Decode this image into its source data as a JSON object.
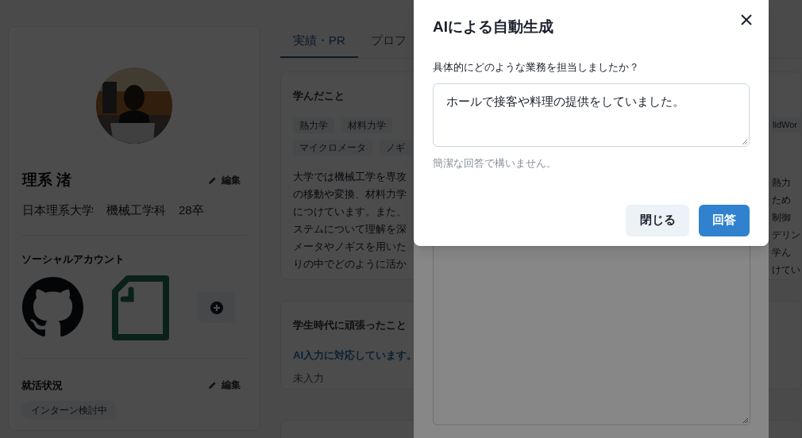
{
  "profile": {
    "name": "理系 渚",
    "edit_label": "編集",
    "affiliation": [
      "日本理系大学",
      "機械工学科",
      "28卒"
    ],
    "social_heading": "ソーシャルアカウント"
  },
  "job_status": {
    "heading": "就活状況",
    "edit_label": "編集",
    "tags": [
      "インターン検討中"
    ]
  },
  "tabs": [
    {
      "label": "実績・PR",
      "selected": true
    },
    {
      "label": "プロフ",
      "selected": false
    }
  ],
  "learned": {
    "title": "学んだこと",
    "tag_rows": [
      [
        "熱力学",
        "材料力学"
      ],
      [
        "マイクロメータ",
        "ノギ"
      ]
    ],
    "right_tag": "lidWor",
    "text_left": [
      "大学では機械工学を専攻",
      "の移動や変換、材料力学",
      "につけています。また、",
      "ステムについて理解を深",
      "メータやノギスを用いた",
      "りの中でどのように活か"
    ],
    "text_right": [
      "熱力",
      "ため",
      "制御",
      "デリン",
      "学ん",
      "けてい"
    ]
  },
  "effort": {
    "title": "学生時代に頑張ったこと",
    "ai_note": "AI入力に対応しています。",
    "value": "未入力"
  },
  "modal": {
    "title": "AIによる自動生成",
    "question": "具体的にどのような業務を担当しましたか？",
    "answer": "ホールで接客や料理の提供をしていました。",
    "hint": "簡潔な回答で構いません。",
    "buttons": [
      {
        "label": "閉じる",
        "kind": "secondary"
      },
      {
        "label": "回答",
        "kind": "primary"
      }
    ]
  }
}
